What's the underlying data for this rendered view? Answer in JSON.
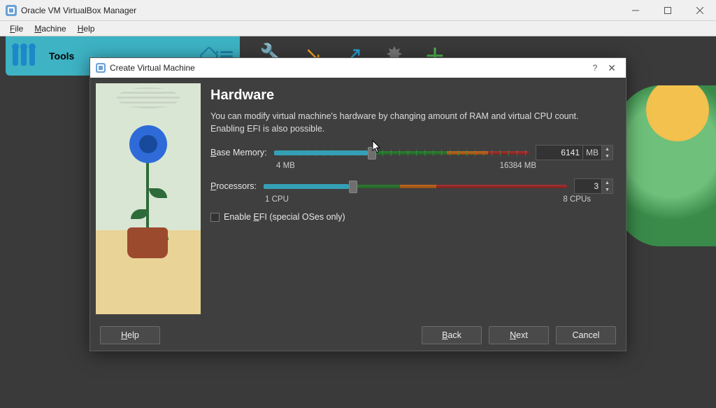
{
  "window": {
    "title": "Oracle VM VirtualBox Manager"
  },
  "menubar": {
    "file": "File",
    "machine": "Machine",
    "help": "Help"
  },
  "tools_label": "Tools",
  "dialog": {
    "title": "Create Virtual Machine",
    "heading": "Hardware",
    "description": "You can modify virtual machine's hardware by changing amount of RAM and virtual CPU count. Enabling EFI is also possible.",
    "base_memory_label": "Base Memory:",
    "base_memory_value": "6141",
    "base_memory_unit": "MB",
    "base_memory_min": "4 MB",
    "base_memory_max": "16384 MB",
    "processors_label": "Processors:",
    "processors_value": "3",
    "processors_min": "1 CPU",
    "processors_max": "8 CPUs",
    "efi_label": "Enable EFI (special OSes only)",
    "buttons": {
      "help": "Help",
      "back": "Back",
      "next": "Next",
      "cancel": "Cancel"
    }
  }
}
